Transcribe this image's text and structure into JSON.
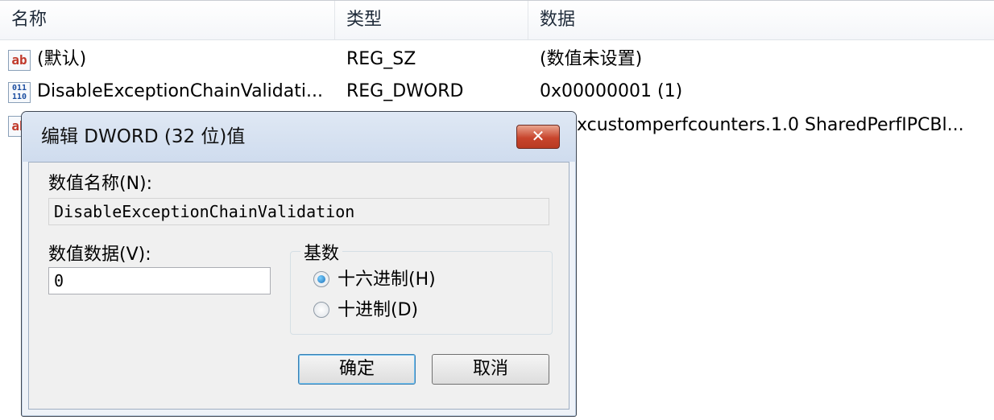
{
  "columns": {
    "name": "名称",
    "type": "类型",
    "data": "数据"
  },
  "rows": [
    {
      "icon": "ab",
      "name": "(默认)",
      "type": "REG_SZ",
      "data": "(数值未设置)"
    },
    {
      "icon": "011\n110",
      "name": "DisableExceptionChainValidati...",
      "type": "REG_DWORD",
      "data": "0x00000001 (1)"
    },
    {
      "icon": "ab",
      "name": "",
      "type": "",
      "data": "xcustomperfcounters.1.0 SharedPerfIPCBl..."
    }
  ],
  "dialog": {
    "title": "编辑 DWORD (32 位)值",
    "close_glyph": "✕",
    "value_name_label": "数值名称(N):",
    "value_name": "DisableExceptionChainValidation",
    "value_data_label": "数值数据(V):",
    "value_data": "0",
    "base_title": "基数",
    "radio_hex": "十六进制(H)",
    "radio_dec": "十进制(D)",
    "selected_base": "hex",
    "ok_label": "确定",
    "cancel_label": "取消"
  }
}
